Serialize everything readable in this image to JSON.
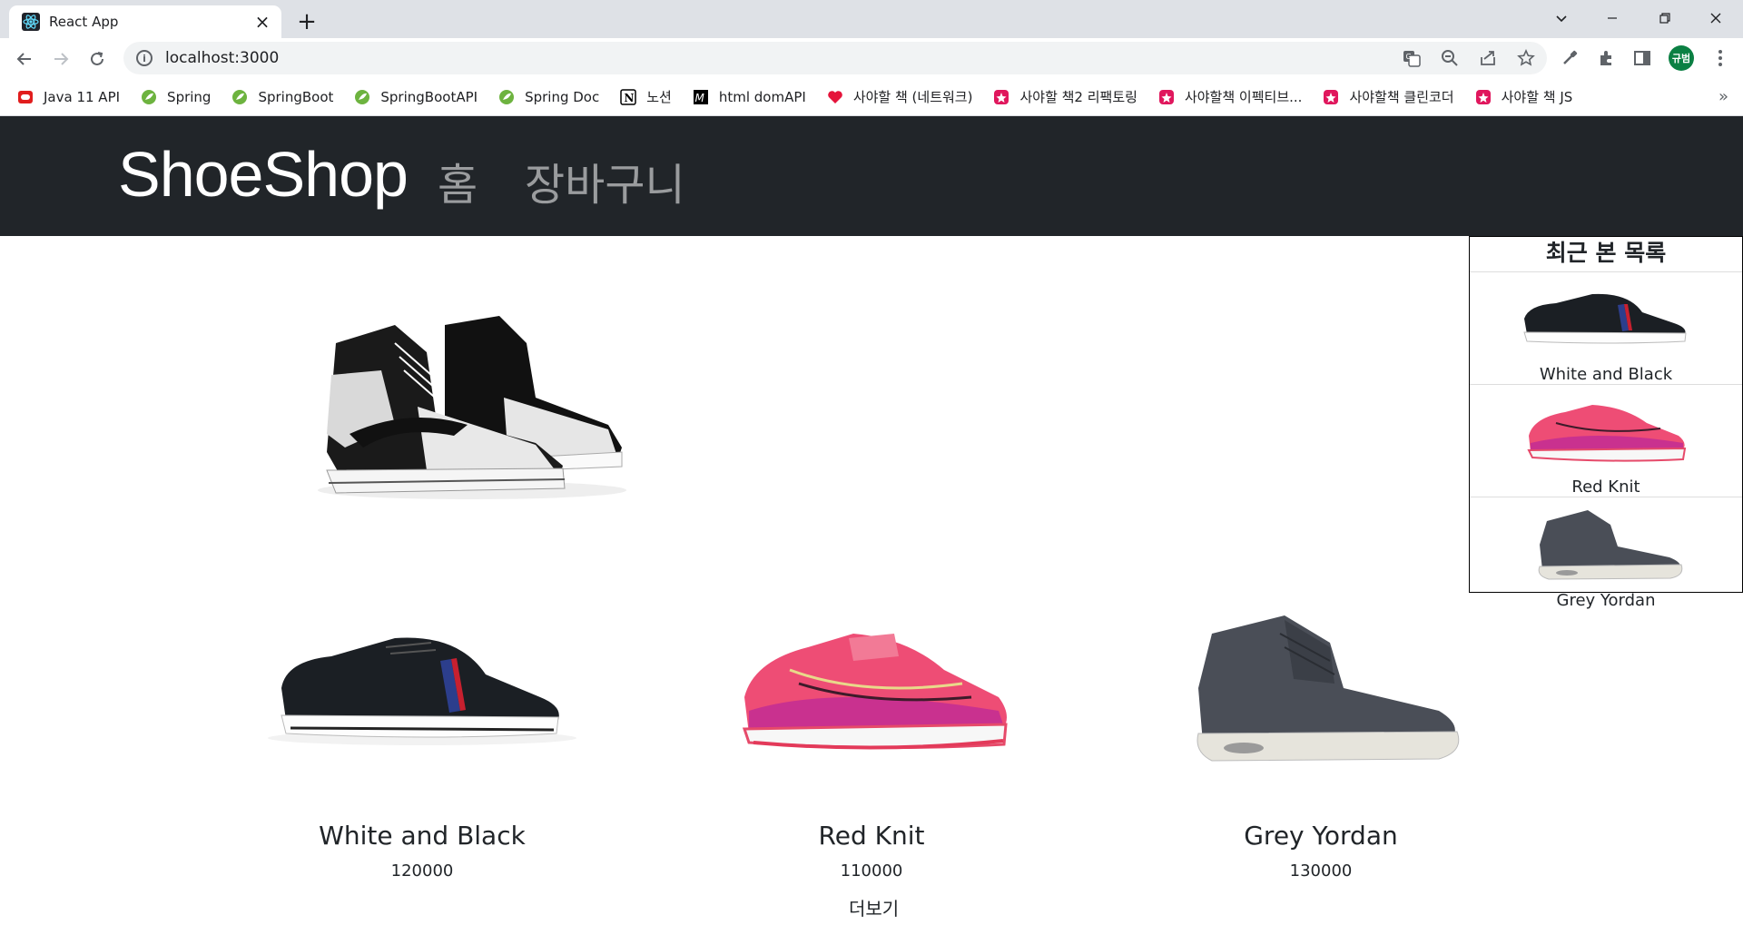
{
  "browser": {
    "tab_title": "React App",
    "url": "localhost:3000",
    "avatar_text": "규범",
    "bookmarks": [
      {
        "label": "Java 11 API",
        "icon": "oracle-icon",
        "color": "#e11d1d"
      },
      {
        "label": "Spring",
        "icon": "spring-icon",
        "color": "#6db33f"
      },
      {
        "label": "SpringBoot",
        "icon": "spring-icon",
        "color": "#6db33f"
      },
      {
        "label": "SpringBootAPI",
        "icon": "spring-icon",
        "color": "#6db33f"
      },
      {
        "label": "Spring Doc",
        "icon": "spring-icon",
        "color": "#6db33f"
      },
      {
        "label": "노션",
        "icon": "notion-icon",
        "color": "#000000"
      },
      {
        "label": "html domAPI",
        "icon": "mdn-icon",
        "color": "#000000"
      },
      {
        "label": "사야할 책 (네트워크)",
        "icon": "heart-icon",
        "color": "#e5143b"
      },
      {
        "label": "사야할 책2 리팩토링",
        "icon": "bookmark-app-icon",
        "color": "#e0175d"
      },
      {
        "label": "사야할책 이펙티브...",
        "icon": "bookmark-app-icon",
        "color": "#e0175d"
      },
      {
        "label": "사야할책 클린코더",
        "icon": "bookmark-app-icon",
        "color": "#e0175d"
      },
      {
        "label": "사야할 책 JS",
        "icon": "bookmark-app-icon",
        "color": "#e0175d"
      }
    ]
  },
  "navbar": {
    "brand": "ShoeShop",
    "links": [
      "홈",
      "장바구니"
    ]
  },
  "products": [
    {
      "title": "White and Black",
      "price": "120000",
      "image": "black-sneaker"
    },
    {
      "title": "Red Knit",
      "price": "110000",
      "image": "pink-running-shoe"
    },
    {
      "title": "Grey Yordan",
      "price": "130000",
      "image": "grey-highcut"
    }
  ],
  "more_label": "더보기",
  "recent": {
    "title": "최근 본 목록",
    "items": [
      {
        "name": "White and Black",
        "image": "black-sneaker"
      },
      {
        "name": "Red Knit",
        "image": "pink-running-shoe"
      },
      {
        "name": "Grey Yordan",
        "image": "grey-highcut"
      }
    ]
  },
  "colors": {
    "navbar_bg": "#212529",
    "nav_link": "rgba(255,255,255,0.55)",
    "accent_pink": "#e84a7a"
  }
}
